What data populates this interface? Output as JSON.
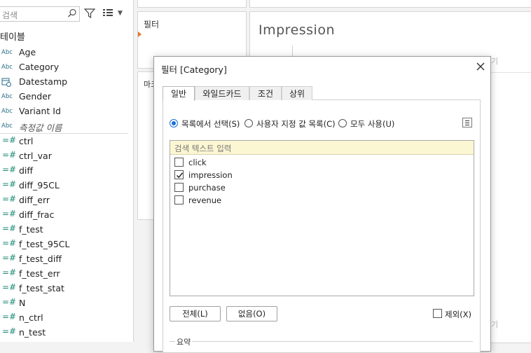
{
  "left_pane": {
    "search_placeholder": "검색",
    "tables_heading": "테이블",
    "fields": [
      {
        "type": "Abc",
        "name": "Age"
      },
      {
        "type": "Abc",
        "name": "Category"
      },
      {
        "type": "calendar",
        "name": "Datestamp"
      },
      {
        "type": "Abc",
        "name": "Gender"
      },
      {
        "type": "Abc",
        "name": "Variant Id"
      },
      {
        "type": "Abc",
        "name": "측정값 이름",
        "italic": true
      }
    ],
    "measures": [
      "ctrl",
      "ctrl_var",
      "diff",
      "diff_95CL",
      "diff_err",
      "diff_frac",
      "f_test",
      "f_test_95CL",
      "f_test_diff",
      "f_test_err",
      "f_test_stat",
      "N",
      "n_ctrl",
      "n_test"
    ],
    "measure_type_glyph": "=#"
  },
  "shelves": {
    "filters_label": "필터",
    "marks_label": "마크"
  },
  "sheet": {
    "title": "Impression",
    "ghost_text_1": "기",
    "ghost_text_2": "기"
  },
  "dialog": {
    "title": "필터 [Category]",
    "tabs": [
      "일반",
      "와일드카드",
      "조건",
      "상위"
    ],
    "active_tab": "일반",
    "radios": [
      {
        "label": "목록에서 선택(S)",
        "selected": true
      },
      {
        "label": "사용자 지정 값 목록(C)",
        "selected": false
      },
      {
        "label": "모두 사용(U)",
        "selected": false
      }
    ],
    "list_search_placeholder": "검색 텍스트 입력",
    "items": [
      {
        "label": "click",
        "checked": false
      },
      {
        "label": "impression",
        "checked": true
      },
      {
        "label": "purchase",
        "checked": false
      },
      {
        "label": "revenue",
        "checked": false
      }
    ],
    "all_button": "전체(L)",
    "none_button": "없음(O)",
    "exclude_label": "제외(X)",
    "summary_label": "요약"
  },
  "colors": {
    "accent_blue": "#1a6fd8",
    "search_highlight": "#fcf7d3",
    "filter_arrow": "#e8762c"
  }
}
